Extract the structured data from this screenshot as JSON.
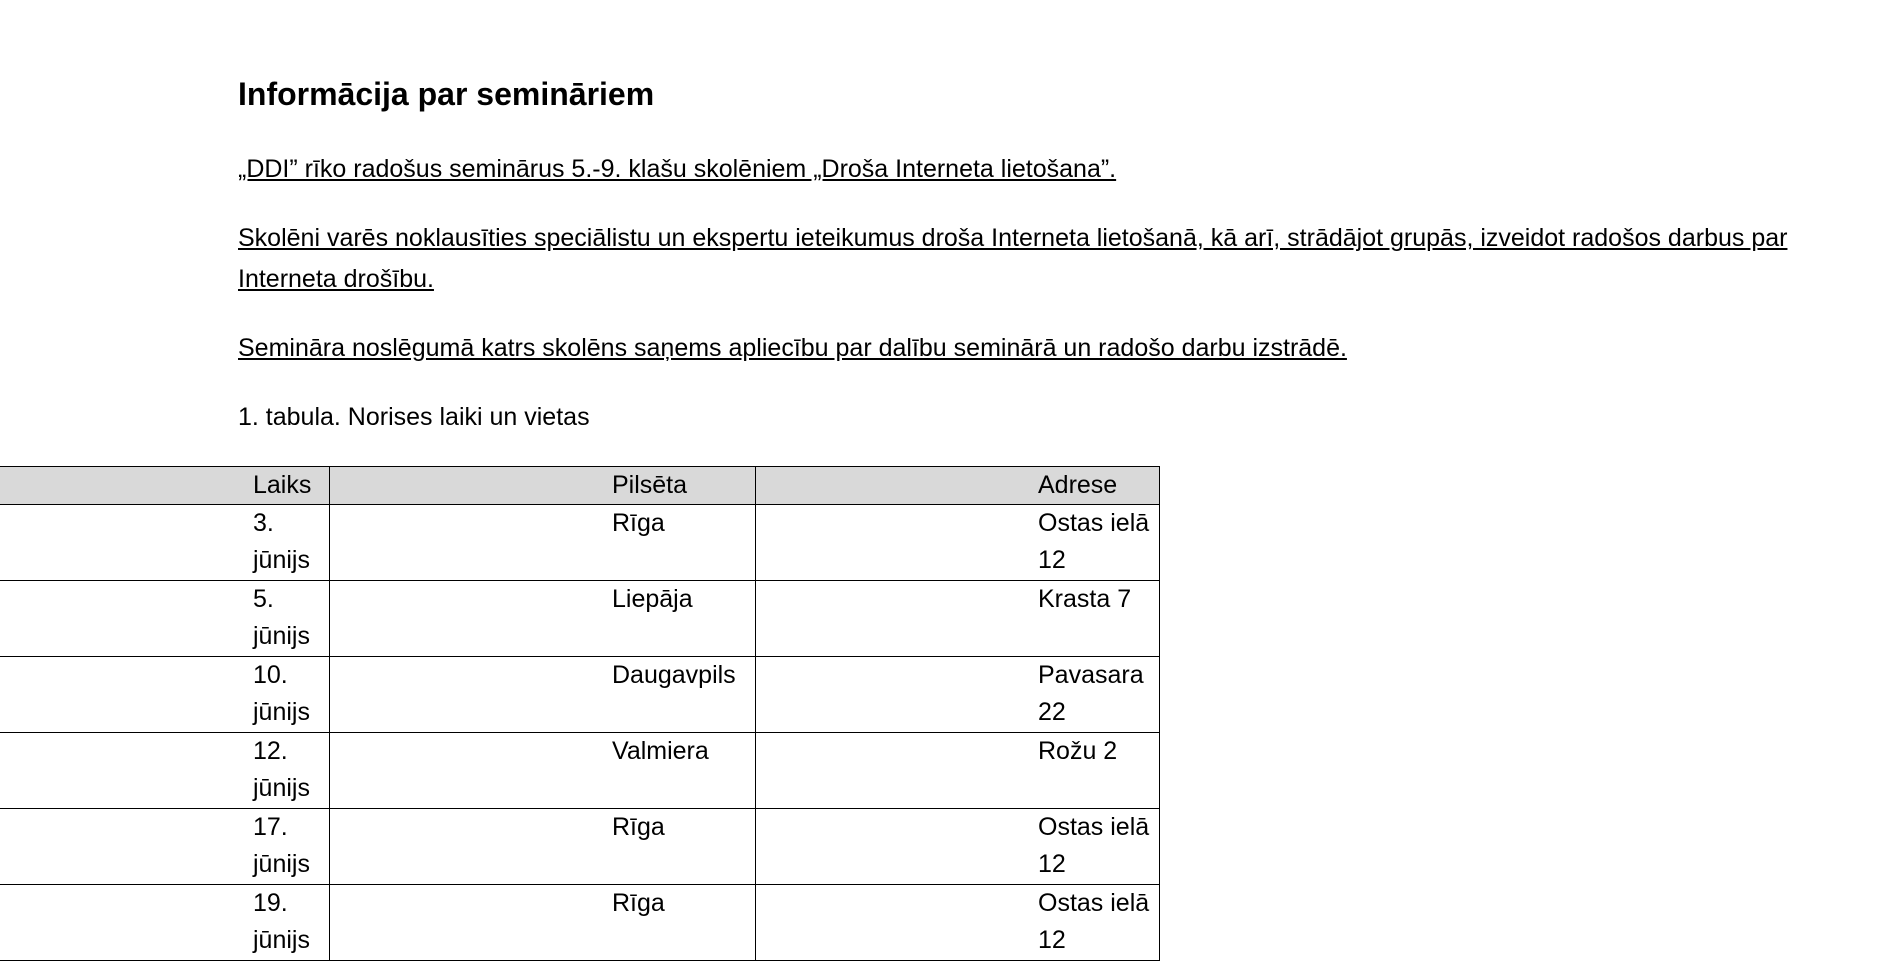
{
  "document": {
    "heading": "Informācija par semināriem",
    "paragraph_1": "„DDI” rīko radošus seminārus 5.-9. klašu skolēniem „Droša Interneta lietošana”.",
    "paragraph_2": "Skolēni varēs noklausīties speciālistu un ekspertu ieteikumus droša Interneta lietošanā, kā arī, strādājot grupās, izveidot radošos darbus par Interneta drošību.",
    "paragraph_3": "Semināra noslēgumā katrs skolēns saņems apliecību par dalību seminārā un radošo darbu izstrādē.",
    "table_caption": "1. tabula. Norises laiki un vietas"
  },
  "table": {
    "headers": [
      "Laiks",
      "Pilsēta",
      "Adrese"
    ],
    "rows": [
      [
        "3. jūnijs",
        "Rīga",
        "Ostas ielā 12"
      ],
      [
        "5. jūnijs",
        "Liepāja",
        "Krasta 7"
      ],
      [
        "10. jūnijs",
        "Daugavpils",
        "Pavasara 22"
      ],
      [
        "12. jūnijs",
        "Valmiera",
        "Rožu 2"
      ],
      [
        "17. jūnijs",
        "Rīga",
        "Ostas ielā 12"
      ],
      [
        "19. jūnijs",
        "Rīga",
        "Ostas ielā 12"
      ]
    ]
  }
}
